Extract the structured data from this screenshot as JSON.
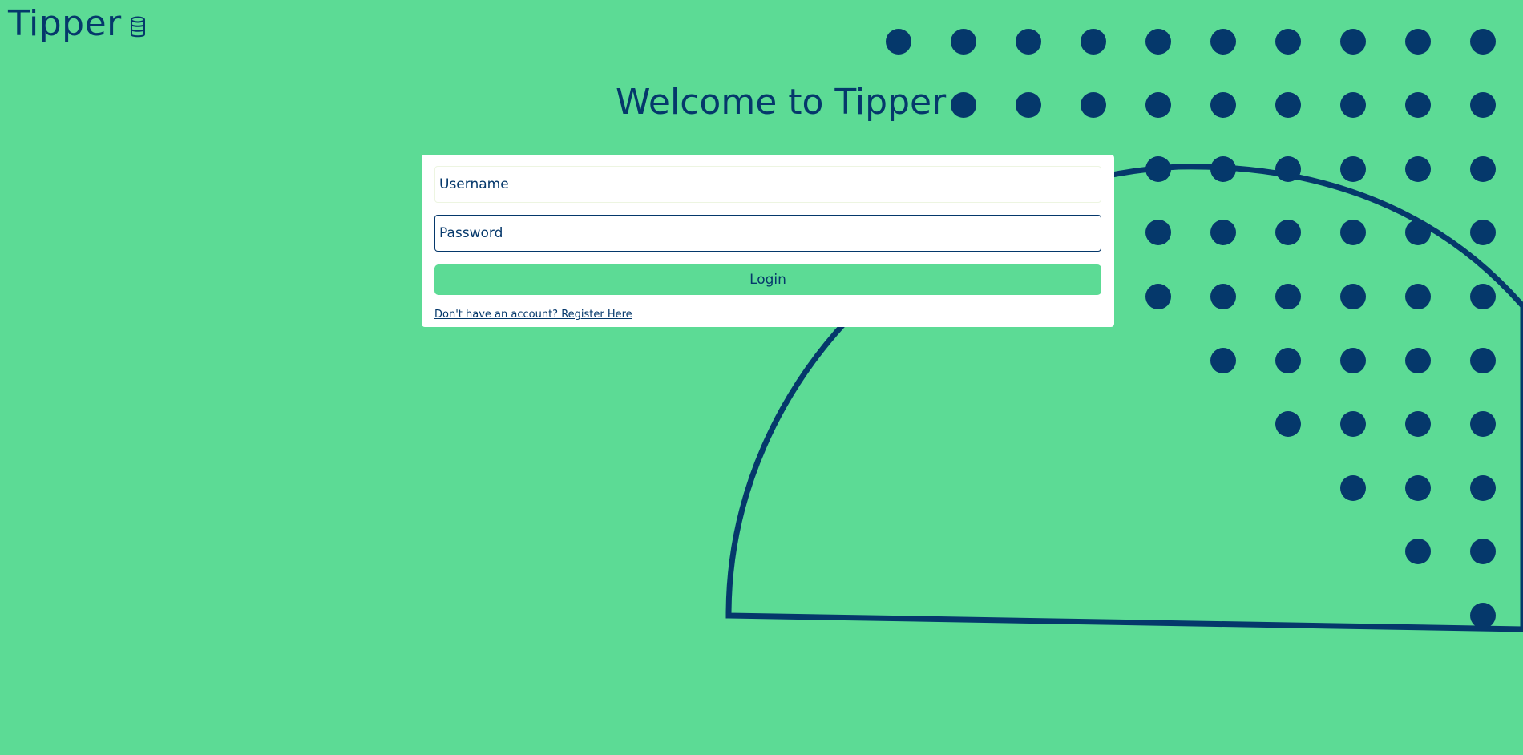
{
  "brand": {
    "name": "Tipper",
    "icon": "coins-stack-icon"
  },
  "page": {
    "title": "Welcome to Tipper"
  },
  "login_form": {
    "username_placeholder": "Username",
    "username_value": "",
    "password_placeholder": "Password",
    "password_value": "",
    "login_label": "Login",
    "register_text": "Don't have an account? Register Here"
  },
  "colors": {
    "background": "#5cdb95",
    "primary": "#05386b",
    "card": "#ffffff",
    "button": "#5cdb95"
  }
}
